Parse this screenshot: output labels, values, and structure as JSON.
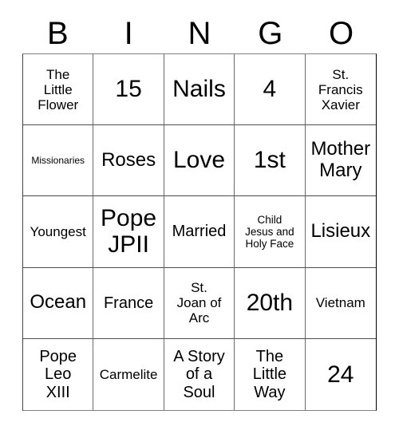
{
  "card": {
    "title_letters": [
      "B",
      "I",
      "N",
      "G",
      "O"
    ],
    "columns": 5,
    "rows": 5,
    "text_color": "#000000",
    "cell_background": "#ffffff",
    "border_color": "#000000"
  },
  "cells": [
    {
      "text": "The\nLittle\nFlower",
      "size": "md"
    },
    {
      "text": "15",
      "size": "xxl"
    },
    {
      "text": "Nails",
      "size": "xxl"
    },
    {
      "text": "4",
      "size": "xxl"
    },
    {
      "text": "St.\nFrancis\nXavier",
      "size": "md"
    },
    {
      "text": "Missionaries",
      "size": "xs"
    },
    {
      "text": "Roses",
      "size": "xl"
    },
    {
      "text": "Love",
      "size": "xxl"
    },
    {
      "text": "1st",
      "size": "xxl"
    },
    {
      "text": "Mother\nMary",
      "size": "xl"
    },
    {
      "text": "Youngest",
      "size": "md"
    },
    {
      "text": "Pope\nJPII",
      "size": "xxl"
    },
    {
      "text": "Married",
      "size": "lg"
    },
    {
      "text": "Child\nJesus and\nHoly Face",
      "size": "sm"
    },
    {
      "text": "Lisieux",
      "size": "xl"
    },
    {
      "text": "Ocean",
      "size": "xl"
    },
    {
      "text": "France",
      "size": "lg"
    },
    {
      "text": "St.\nJoan of\nArc",
      "size": "md"
    },
    {
      "text": "20th",
      "size": "xxl"
    },
    {
      "text": "Vietnam",
      "size": "md"
    },
    {
      "text": "Pope\nLeo\nXIII",
      "size": "lg"
    },
    {
      "text": "Carmelite",
      "size": "md"
    },
    {
      "text": "A Story\nof a\nSoul",
      "size": "lg"
    },
    {
      "text": "The\nLittle\nWay",
      "size": "lg"
    },
    {
      "text": "24",
      "size": "xxl"
    }
  ]
}
